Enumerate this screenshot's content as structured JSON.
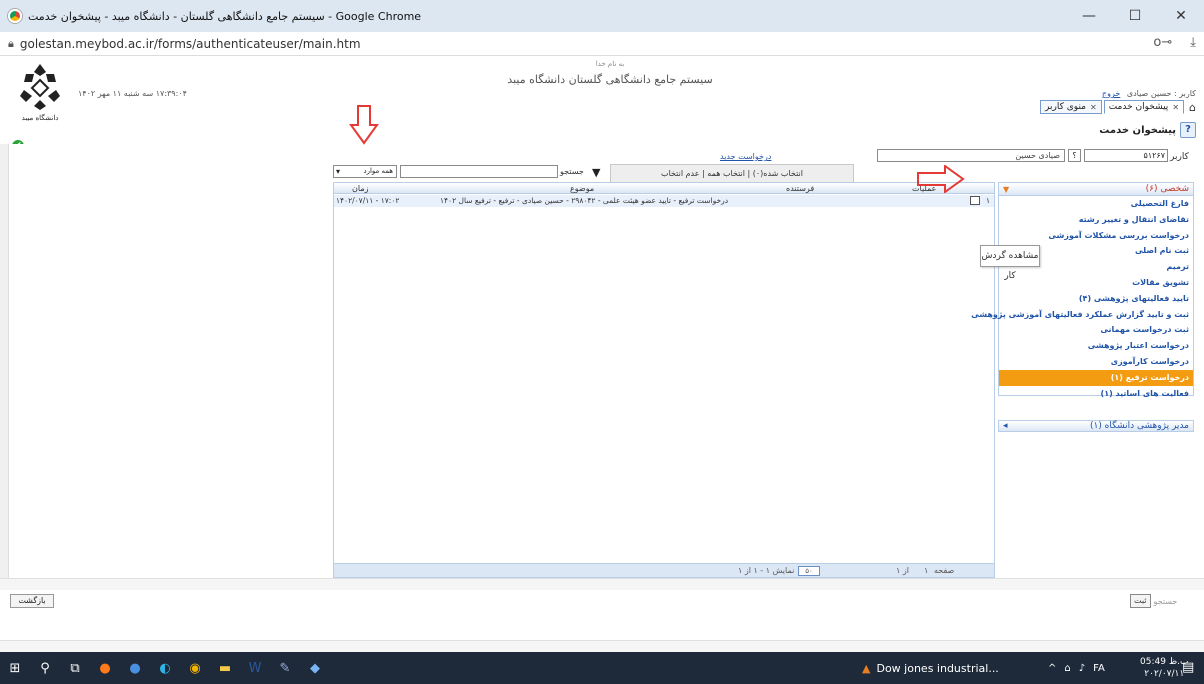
{
  "window": {
    "title": "سیستم جامع دانشگاهی گلستان - دانشگاه میبد - پیشخوان خدمت - Google Chrome",
    "minimize": "—",
    "maximize": "☐",
    "close": "✕"
  },
  "address": {
    "url": "golestan.meybod.ac.ir/forms/authenticateuser/main.htm",
    "key_icon": "o⊸",
    "download_icon": "⤓"
  },
  "header": {
    "bismillah": "به نام خدا",
    "system_title": "سیستم جامع دانشگاهی گلستان   دانشگاه میبد",
    "datetime": "۱۷:۳۹:۰۴  سه شنبه ۱۱ مهر ۱۴۰۲",
    "user_prefix": "کاربر : حسین صیادی",
    "exit": "خروج",
    "check": "✔"
  },
  "tabs": [
    {
      "label": "پیشخوان خدمت",
      "active": true
    },
    {
      "label": "منوی کاربر",
      "active": false
    }
  ],
  "page_head": {
    "title": "پیشخوان خدمت",
    "help": "?"
  },
  "form": {
    "new_request": "درخواست جدید",
    "user_label": "کاربر",
    "user_code": "۵۱۲۶۷",
    "user_help": "؟",
    "user_name": "صیادی حسین",
    "select_bar": "انتخاب شده(۰) | انتخاب همه | عدم انتخاب",
    "search_label": "جستجو",
    "scope_value": "همه موارد",
    "scope_dd": "▾"
  },
  "grid": {
    "columns": {
      "ops": "عملیات",
      "sender": "فرستنده",
      "subject": "موضوع",
      "time": "زمان"
    },
    "rows": [
      {
        "num": "۱",
        "subject": "درخواست ترفیع - تایید عضو هیئت علمی - ۲۹۸۰۴۲ - حسین صیادی - ترفیع - ترفیع سال ۱۴۰۲",
        "time": "۱۴۰۲/۰۷/۱۱ - ۱۷:۰۲"
      }
    ],
    "footer": {
      "page_label": "صفحه",
      "page_num": "۱",
      "of_label": "از ۱",
      "page_size": "۵۰",
      "display": "نمایش ۱ - ۱ از ۱"
    }
  },
  "tooltip": "مشاهده گردش کار",
  "sidebar": {
    "section1": "شخصی (۶)",
    "items": [
      "فارغ التحصیلی",
      "تقاضای انتقال و تغییر رشته",
      "درخواست بررسی مشکلات آموزشی",
      "ثبت نام اصلی",
      "ترمیم",
      "تشویق مقالات",
      "تایید فعالیتهای پژوهشی (۴)",
      "ثبت و تایید گزارش عملکرد فعالیتهای آموزشی پژوهشی",
      "ثبت درخواست مهمانی",
      "درخواست اعتبار پژوهشی",
      "درخواست کارآموزی",
      "درخواست ترفیع (۱)",
      "فعالیت های اساتید (۱)"
    ],
    "active_index": 11,
    "section2": "مدیر پژوهشی دانشگاه (۱)"
  },
  "bottom": {
    "back": "بازگشت",
    "go": "جستجو",
    "right_btn": "ثبت"
  },
  "taskbar": {
    "news": "Dow jones industrial...",
    "clock_time": "05:49 ب.ظ",
    "clock_date": "۲۰۲/۰۷/۱۱",
    "lang": "FA"
  },
  "colors": {
    "accent": "#f39c12",
    "link": "#2154a8",
    "annotation": "#e53935"
  }
}
